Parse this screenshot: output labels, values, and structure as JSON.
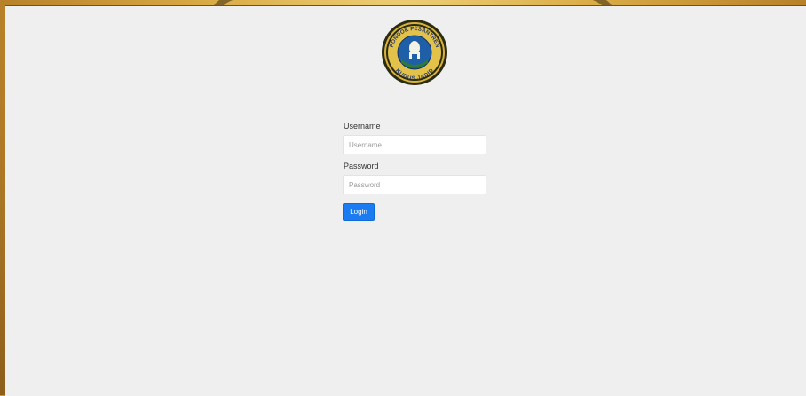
{
  "logo": {
    "name": "institution-emblem",
    "text_top": "PONDOK PESANTREN",
    "text_bottom": "KUDUS JADID"
  },
  "login_form": {
    "username_label": "Username",
    "username_placeholder": "Username",
    "username_value": "",
    "password_label": "Password",
    "password_placeholder": "Password",
    "password_value": "",
    "submit_label": "Login"
  },
  "colors": {
    "panel_bg": "#efefef",
    "button_bg": "#1a7cf0",
    "emblem_gold": "#d9b23a",
    "emblem_blue": "#1e5fa8",
    "emblem_green": "#2f7a3a"
  }
}
